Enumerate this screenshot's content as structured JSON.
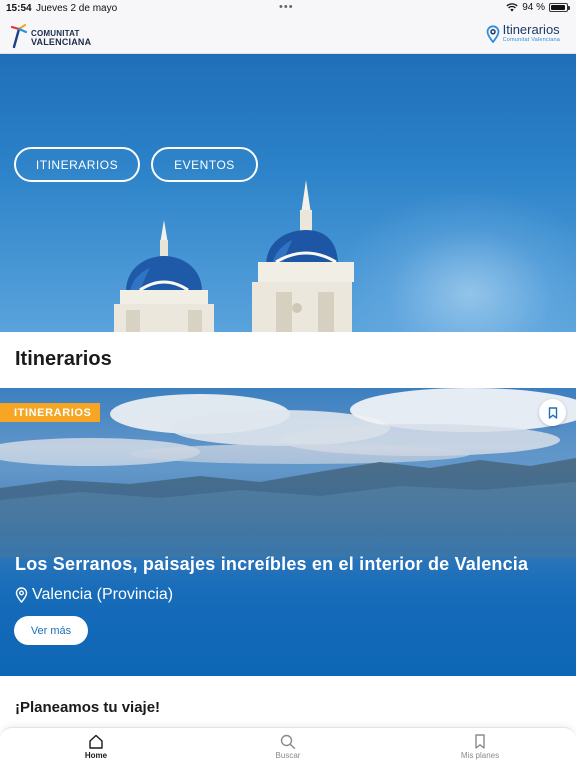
{
  "status_bar": {
    "time": "15:54",
    "date": "Jueves 2 de mayo",
    "battery": "94 %",
    "battery_level": 0.94
  },
  "header": {
    "brand_line1": "COMUNITAT",
    "brand_line2": "VALENCIANA",
    "app_title": "Itinerarios",
    "app_subtitle": "Comunitat Valenciana"
  },
  "hero": {
    "buttons": [
      {
        "label": "ITINERARIOS"
      },
      {
        "label": "EVENTOS"
      }
    ]
  },
  "section": {
    "title": "Itinerarios"
  },
  "card": {
    "badge": "ITINERARIOS",
    "title": "Los Serranos, paisajes increíbles en el interior de Valencia",
    "location": "Valencia (Provincia)",
    "cta": "Ver más"
  },
  "plan": {
    "title": "¡Planeamos tu viaje!"
  },
  "tabs": [
    {
      "label": "Home",
      "icon": "home-icon",
      "active": true
    },
    {
      "label": "Buscar",
      "icon": "search-icon",
      "active": false
    },
    {
      "label": "Mis planes",
      "icon": "bookmark-icon",
      "active": false
    }
  ],
  "colors": {
    "accent_blue": "#1d6fb9",
    "badge_orange": "#f6a623",
    "header_bg": "#f7f7f9"
  }
}
